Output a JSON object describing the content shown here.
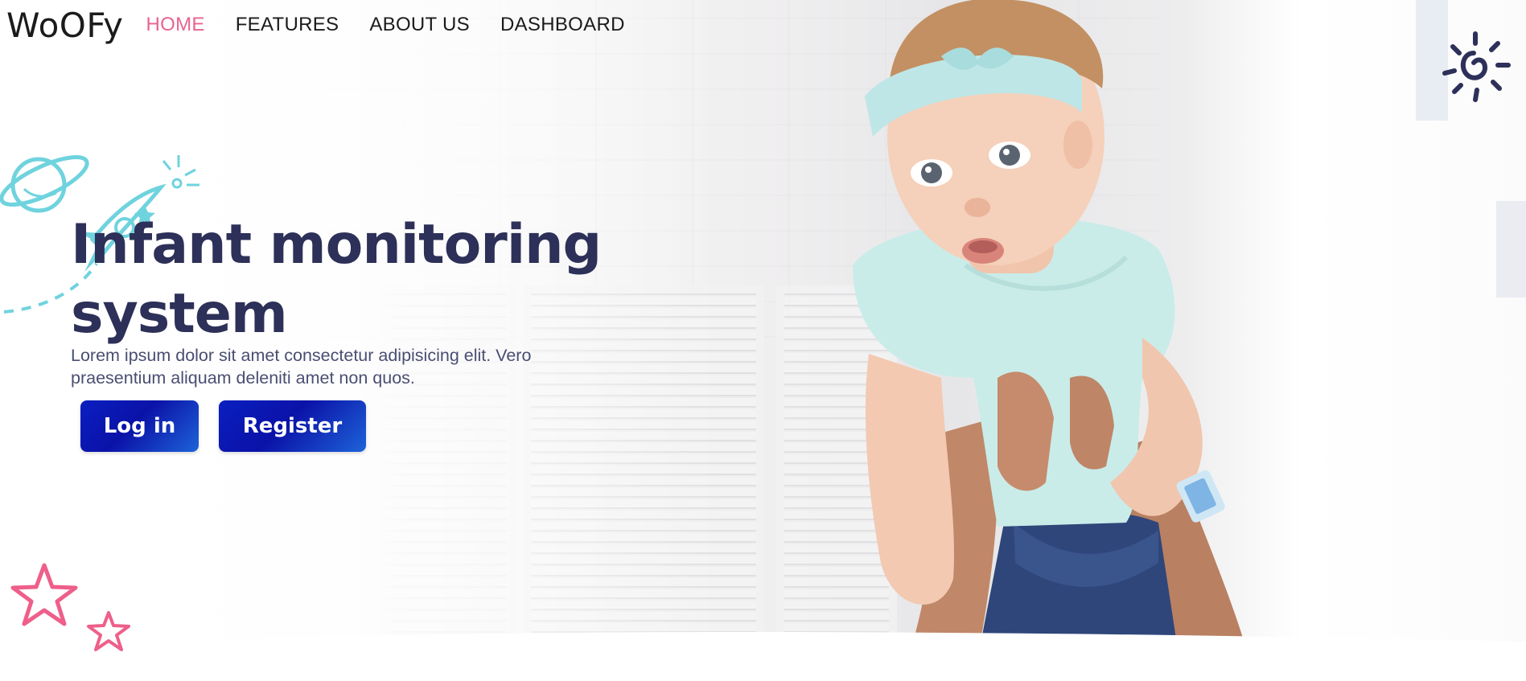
{
  "brand": {
    "logo": "WoOFy"
  },
  "nav": {
    "items": [
      {
        "label": "HOME",
        "active": true
      },
      {
        "label": "FEATURES",
        "active": false
      },
      {
        "label": "ABOUT US",
        "active": false
      },
      {
        "label": "DASHBOARD",
        "active": false
      }
    ]
  },
  "hero": {
    "title_line1": "Infant monitoring",
    "title_line2": "system",
    "description": "Lorem ipsum dolor sit amet consectetur adipisicing elit. Vero praesentium aliquam deleniti amet non quos.",
    "login_label": "Log in",
    "register_label": "Register"
  },
  "colors": {
    "accent_pink": "#e8638f",
    "title_navy": "#2d3058",
    "button_blue": "#0b12a8",
    "doodle_cyan": "#6fd3de"
  },
  "icons": [
    "planet-icon",
    "rocket-icon",
    "sun-icon",
    "star-icon"
  ]
}
